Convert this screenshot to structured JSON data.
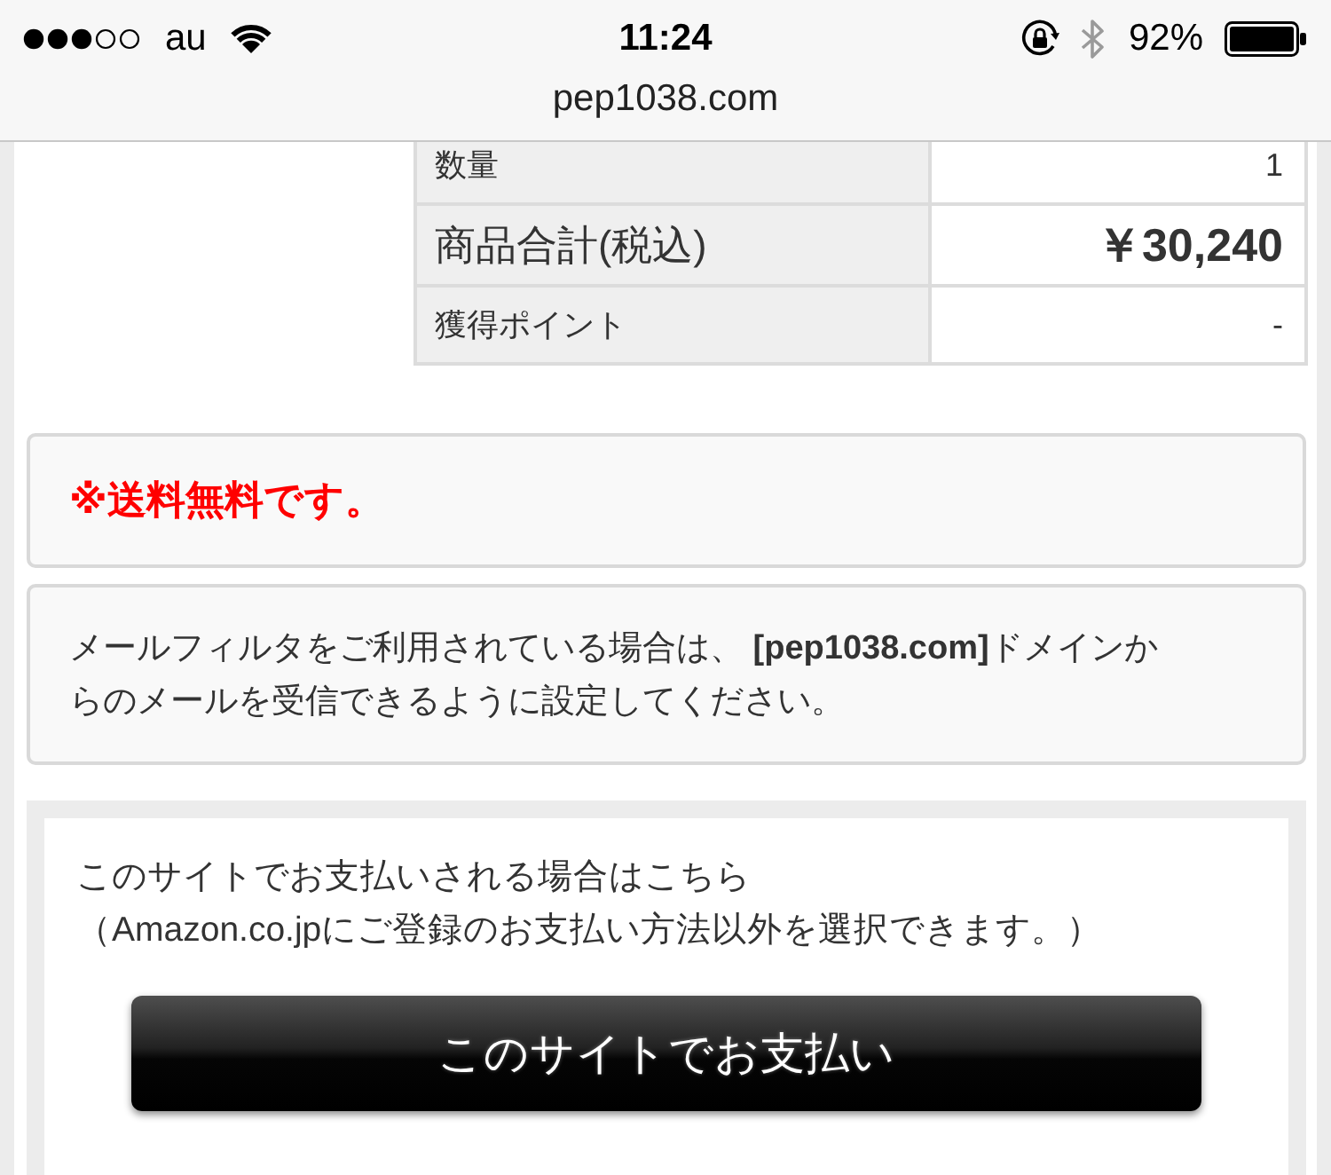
{
  "status_bar": {
    "carrier": "au",
    "time": "11:24",
    "battery": "92%"
  },
  "address_bar": {
    "url": "pep1038.com"
  },
  "summary_table": {
    "rows": [
      {
        "kind": "normal",
        "label": "数量",
        "value": "1"
      },
      {
        "kind": "total",
        "label": "商品合計(税込)",
        "value": "￥30,240"
      },
      {
        "kind": "normal",
        "label": "獲得ポイント",
        "value": "-"
      }
    ]
  },
  "notices": [
    {
      "kind": "alert",
      "text": "※送料無料です。"
    },
    {
      "kind": "info",
      "text": "メールフィルタをご利用されている場合は、 **[pep1038.com]**ドメインからのメールを受信できるように設定してください。"
    }
  ],
  "payment_panel": {
    "lines": [
      "このサイトでお支払いされる場合はこちら",
      "（Amazon.co.jpにご登録のお支払い方法以外を選択できます。）"
    ],
    "button": "このサイトでお支払い"
  }
}
